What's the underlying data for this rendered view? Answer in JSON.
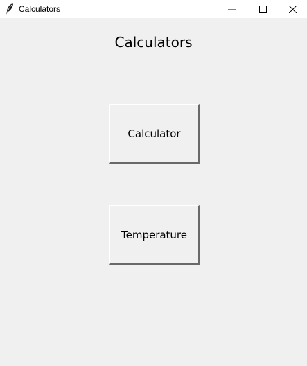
{
  "window": {
    "title": "Calculators",
    "icon": "feather-icon",
    "controls": [
      "minimize-icon",
      "maximize-icon",
      "close-icon"
    ]
  },
  "main": {
    "heading": "Calculators",
    "buttons": [
      {
        "label": "Calculator"
      },
      {
        "label": "Temperature"
      }
    ]
  }
}
